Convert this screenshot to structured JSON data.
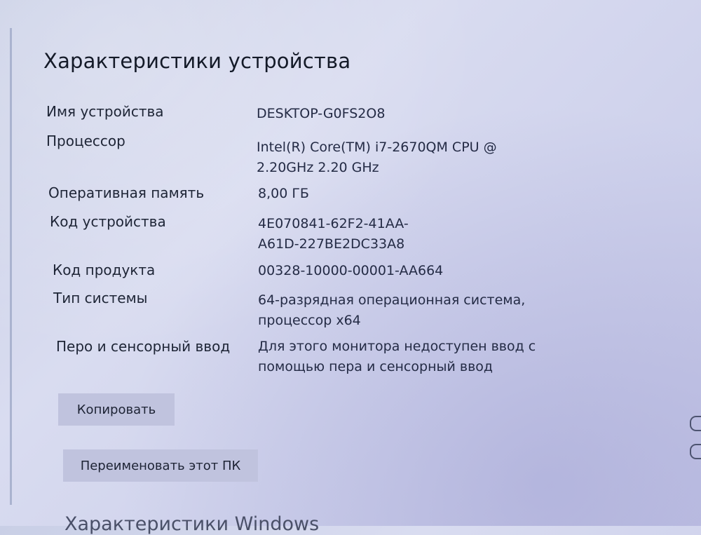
{
  "page": {
    "title": "Характеристики устройства"
  },
  "specs": [
    {
      "label": "Имя устройства",
      "value_lines": [
        "DESKTOP-G0FS2O8"
      ]
    },
    {
      "label": "Процессор",
      "value_lines": [
        "Intel(R) Core(TM) i7-2670QM CPU @",
        "2.20GHz   2.20 GHz"
      ]
    },
    {
      "label": "Оперативная память",
      "value_lines": [
        "8,00 ГБ"
      ]
    },
    {
      "label": "Код устройства",
      "value_lines": [
        "4E070841-62F2-41AA-",
        "A61D-227BE2DC33A8"
      ]
    },
    {
      "label": "Код продукта",
      "value_lines": [
        "00328-10000-00001-AA664"
      ]
    },
    {
      "label": "Тип системы",
      "value_lines": [
        "64-разрядная операционная система,",
        "процессор x64"
      ]
    },
    {
      "label": "Перо и сенсорный ввод",
      "value_lines": [
        "Для этого монитора недоступен ввод с",
        "помощью пера и сенсорный ввод"
      ]
    }
  ],
  "buttons": {
    "copy_label": "Копировать",
    "rename_label": "Переименовать этот ПК"
  },
  "next_section": {
    "title": "Характеристики Windows"
  },
  "edge_icons": [
    "help-icon",
    "feedback-icon"
  ],
  "colors": {
    "background": "#d3d6ee",
    "button": "#c0c3de",
    "text": "#1d2434"
  }
}
